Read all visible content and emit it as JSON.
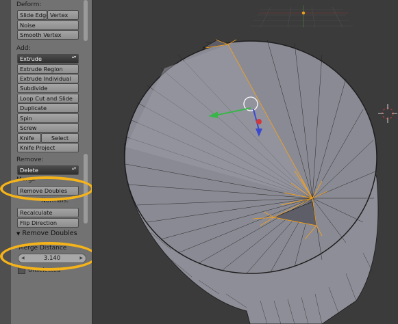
{
  "toolshelf": {
    "deform_header": "Deform:",
    "slide_edge": "Slide Edge",
    "vertex": "Vertex",
    "noise": "Noise",
    "smooth_vertex": "Smooth Vertex",
    "add_header": "Add:",
    "extrude_dropdown": "Extrude",
    "extrude_region": "Extrude Region",
    "extrude_individual": "Extrude Individual",
    "subdivide": "Subdivide",
    "loop_cut_and_slide": "Loop Cut and Slide",
    "duplicate": "Duplicate",
    "spin": "Spin",
    "screw": "Screw",
    "knife": "Knife",
    "select": "Select",
    "knife_project": "Knife Project",
    "remove_header": "Remove:",
    "delete_dropdown": "Delete",
    "merge_label": "Merge",
    "remove_doubles": "Remove Doubles",
    "normals_header": "Normals:",
    "recalculate": "Recalculate",
    "flip_direction": "Flip Direction"
  },
  "redo_panel": {
    "title": "Remove Doubles",
    "merge_distance_label": "Merge Distance",
    "merge_distance_value": "3.140",
    "unselected_label": "Unselected"
  },
  "colors": {
    "annotation": "#f5b31a",
    "selected_edges": "#f0a020",
    "mesh_face": "#8e8e98"
  }
}
